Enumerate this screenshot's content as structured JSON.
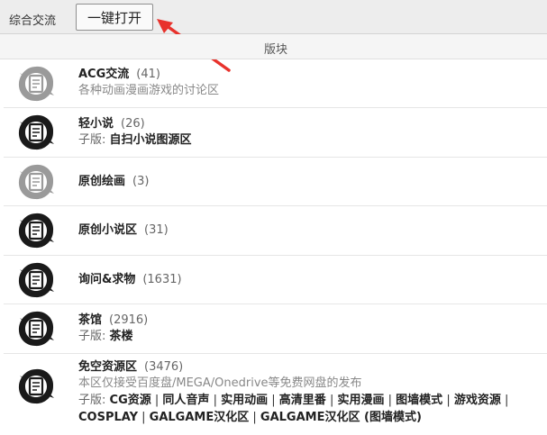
{
  "category": {
    "title": "综合交流",
    "open_all_label": "一键打开"
  },
  "header": {
    "column_label": "版块"
  },
  "forums": [
    {
      "name": "ACG交流",
      "count": "(41)",
      "description": "各种动画漫画游戏的讨论区",
      "icon_state": "inactive"
    },
    {
      "name": "轻小说",
      "count": "(26)",
      "subforum_prefix": "子版:",
      "subforums": [
        "自扫小说图源区"
      ],
      "icon_state": "active"
    },
    {
      "name": "原创绘画",
      "count": "(3)",
      "icon_state": "inactive"
    },
    {
      "name": "原创小说区",
      "count": "(31)",
      "icon_state": "active"
    },
    {
      "name": "询问&求物",
      "count": "(1631)",
      "icon_state": "active"
    },
    {
      "name": "茶馆",
      "count": "(2916)",
      "subforum_prefix": "子版:",
      "subforums": [
        "茶楼"
      ],
      "icon_state": "active"
    },
    {
      "name": "免空资源区",
      "count": "(3476)",
      "description": "本区仅接受百度盘/MEGA/Onedrive等免费网盘的发布",
      "subforum_prefix": "子版:",
      "subforums": [
        "CG资源",
        "同人音声",
        "实用动画",
        "高清里番",
        "实用漫画",
        "图墙模式",
        "游戏资源",
        "COSPLAY",
        "GALGAME汉化区",
        "GALGAME汉化区 (图墙模式)"
      ],
      "icon_state": "active"
    }
  ],
  "colors": {
    "icon_active": "#1a1a1a",
    "icon_inactive": "#9a9a9a",
    "arrow": "#e8322c"
  }
}
